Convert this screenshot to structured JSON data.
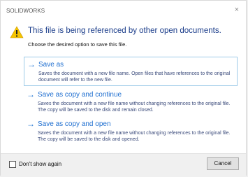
{
  "window": {
    "title": "SOLIDWORKS",
    "close_symbol": "×"
  },
  "message": {
    "icon": "warning-icon",
    "headline": "This file is being referenced by other open documents.",
    "instruction": "Choose the desired option to save this file."
  },
  "options": [
    {
      "title": "Save as",
      "description": "Saves the document with a new file name. Open files that have references to the original document will refer to the new file.",
      "selected": true
    },
    {
      "title": "Save as copy and continue",
      "description": "Saves the document with a new file name without changing references to the original file. The copy will be saved to the disk and remain closed.",
      "selected": false
    },
    {
      "title": "Save as copy and open",
      "description": "Saves the document with a new file name without changing references to the original file. The copy will be saved to the disk and opened.",
      "selected": false
    }
  ],
  "footer": {
    "dont_show_label": "Don't show again",
    "dont_show_checked": false,
    "cancel_label": "Cancel"
  },
  "colors": {
    "accent": "#1f6fd0",
    "headline": "#1a3c8a",
    "warning": "#f5c400"
  }
}
